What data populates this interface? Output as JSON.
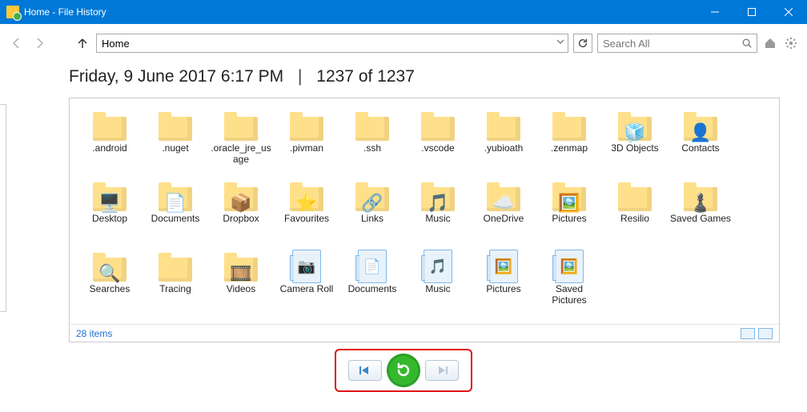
{
  "window": {
    "title": "Home - File History"
  },
  "toolbar": {
    "path": "Home",
    "search_placeholder": "Search All"
  },
  "header": {
    "timestamp": "Friday, 9 June 2017 6:17 PM",
    "position": "1237 of 1237"
  },
  "status": {
    "count_label": "28 items"
  },
  "items": [
    {
      "label": ".android",
      "icon": "folder"
    },
    {
      "label": ".nuget",
      "icon": "folder"
    },
    {
      "label": ".oracle_jre_usage",
      "icon": "folder"
    },
    {
      "label": ".pivman",
      "icon": "folder"
    },
    {
      "label": ".ssh",
      "icon": "folder"
    },
    {
      "label": ".vscode",
      "icon": "folder"
    },
    {
      "label": ".yubioath",
      "icon": "folder"
    },
    {
      "label": ".zenmap",
      "icon": "folder"
    },
    {
      "label": "3D Objects",
      "icon": "folder-3d"
    },
    {
      "label": "Contacts",
      "icon": "folder-contacts"
    },
    {
      "label": "Desktop",
      "icon": "folder-desktop"
    },
    {
      "label": "Documents",
      "icon": "folder-documents"
    },
    {
      "label": "Dropbox",
      "icon": "folder-dropbox"
    },
    {
      "label": "Favourites",
      "icon": "folder-favourites"
    },
    {
      "label": "Links",
      "icon": "folder-links"
    },
    {
      "label": "Music",
      "icon": "folder-music"
    },
    {
      "label": "OneDrive",
      "icon": "folder-onedrive"
    },
    {
      "label": "Pictures",
      "icon": "folder-pictures"
    },
    {
      "label": "Resilio",
      "icon": "folder"
    },
    {
      "label": "Saved Games",
      "icon": "folder-games"
    },
    {
      "label": "Searches",
      "icon": "folder-search"
    },
    {
      "label": "Tracing",
      "icon": "folder"
    },
    {
      "label": "Videos",
      "icon": "folder-videos"
    },
    {
      "label": "Camera Roll",
      "icon": "library-camera"
    },
    {
      "label": "Documents",
      "icon": "library-documents"
    },
    {
      "label": "Music",
      "icon": "library-music"
    },
    {
      "label": "Pictures",
      "icon": "library-pictures"
    },
    {
      "label": "Saved Pictures",
      "icon": "library-pictures"
    }
  ]
}
